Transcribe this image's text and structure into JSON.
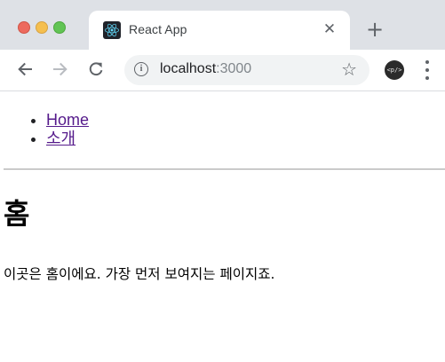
{
  "window": {
    "controls": [
      "close",
      "minimize",
      "zoom"
    ],
    "colors": {
      "close": "#ed6a5e",
      "minimize": "#f5bf4f",
      "zoom": "#61c454",
      "tabstrip": "#dee1e6"
    }
  },
  "tab": {
    "title": "React App",
    "favicon": "react-logo-icon",
    "close_glyph": "✕",
    "new_tab_glyph": "+"
  },
  "toolbar": {
    "back_icon": "arrow-left-icon",
    "forward_icon": "arrow-right-icon",
    "reload_icon": "reload-icon",
    "site_info_icon": "info-icon",
    "site_info_glyph": "i",
    "url_host": "localhost",
    "url_port": ":3000",
    "bookmark_glyph": "☆",
    "profile_label": "<p/>",
    "menu_icon": "more-vertical-icon"
  },
  "page": {
    "nav": [
      {
        "label": "Home"
      },
      {
        "label": "소개"
      }
    ],
    "heading": "홈",
    "text": "이곳은 홈이에요. 가장 먼저 보여지는 페이지죠.",
    "link_color": "#551a8b"
  }
}
